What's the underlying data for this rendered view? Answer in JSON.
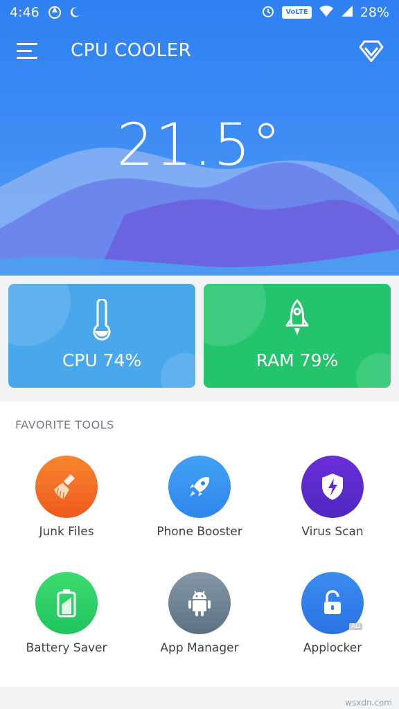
{
  "status_bar": {
    "time": "4:46",
    "volte": "VoLTE",
    "battery": "28%"
  },
  "header": {
    "title": "CPU COOLER"
  },
  "temperature": "21.5°",
  "cards": {
    "cpu": {
      "label": "CPU 74%",
      "color": "#49a8ec"
    },
    "ram": {
      "label": "RAM 79%",
      "color": "#23c46c"
    }
  },
  "tools": {
    "title": "FAVORITE TOOLS",
    "items": [
      {
        "label": "Junk Files",
        "icon": "broom-icon",
        "color": "#f26a22"
      },
      {
        "label": "Phone Booster",
        "icon": "rocket-icon",
        "color": "#2e8ef0"
      },
      {
        "label": "Virus Scan",
        "icon": "shield-icon",
        "color": "#5b2ed0"
      },
      {
        "label": "Battery Saver",
        "icon": "battery-icon",
        "color": "#25cf63"
      },
      {
        "label": "App Manager",
        "icon": "android-icon",
        "color": "#6f8494"
      },
      {
        "label": "Applocker",
        "icon": "lock-icon",
        "color": "#2f7fe8"
      }
    ],
    "ad_badge": "AD"
  },
  "watermark": "wsxdn.com"
}
